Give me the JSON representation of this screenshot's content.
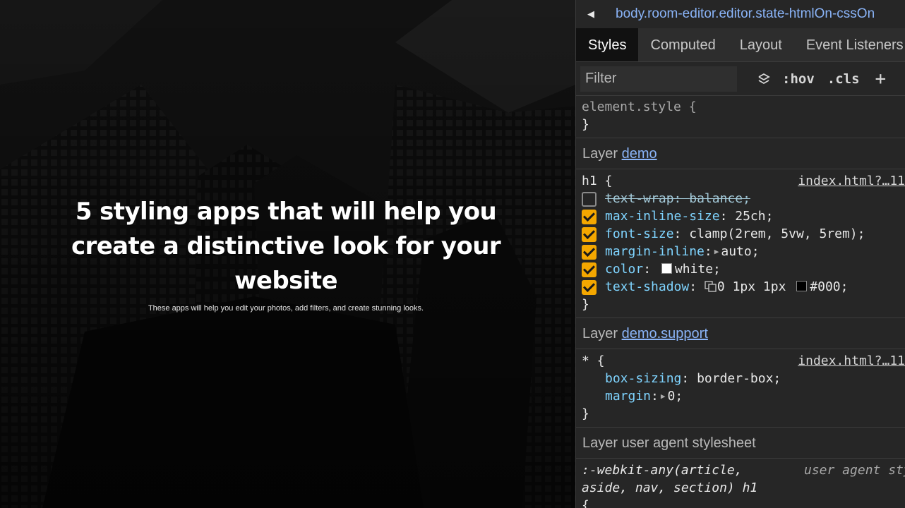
{
  "preview": {
    "title": "5 styling apps that will help you create a distinctive look for your website",
    "subtitle": "These apps will help you edit your photos, add filters, and create stunning looks."
  },
  "devtools": {
    "breadcrumb": "body.room-editor.editor.state-htmlOn-cssOn",
    "tabs": [
      "Styles",
      "Computed",
      "Layout",
      "Event Listeners"
    ],
    "active_tab": "Styles",
    "filter_placeholder": "Filter",
    "hov_label": ":hov",
    "cls_label": ".cls",
    "plus_label": "+",
    "element_style": {
      "open": "element.style {",
      "close": "}"
    },
    "layers": [
      {
        "prefix": "Layer",
        "name": "demo",
        "selector": "h1 {",
        "source": "index.html?…11",
        "declarations": [
          {
            "prop": "text-wrap",
            "value": "balance;",
            "enabled": false
          },
          {
            "prop": "max-inline-size",
            "value": "25ch;",
            "enabled": true
          },
          {
            "prop": "font-size",
            "value": "clamp(2rem, 5vw, 5rem);",
            "enabled": true
          },
          {
            "prop": "margin-inline",
            "value": "auto;",
            "enabled": true
          },
          {
            "prop": "color",
            "value": "white;",
            "enabled": true
          },
          {
            "prop": "text-shadow",
            "value_a": "0 1px 1px",
            "value_b": "#000;",
            "enabled": true
          }
        ],
        "close": "}"
      },
      {
        "prefix": "Layer",
        "name": "demo.support",
        "selector": "* {",
        "source": "index.html?…11",
        "declarations": [
          {
            "prop": "box-sizing",
            "value": "border-box;"
          },
          {
            "prop": "margin",
            "value": "0;"
          }
        ],
        "close": "}"
      },
      {
        "prefix": "Layer",
        "name": "user agent stylesheet",
        "selector_line1": ":-webkit-any(article,",
        "selector_line2": "aside, nav, section) h1",
        "source": "user agent stylesheet",
        "open_brace": "{"
      }
    ],
    "colors": {
      "checkbox": "#f4a700",
      "prop": "#7fd4ff",
      "link": "#8ab4f8",
      "panel": "#262626"
    }
  }
}
